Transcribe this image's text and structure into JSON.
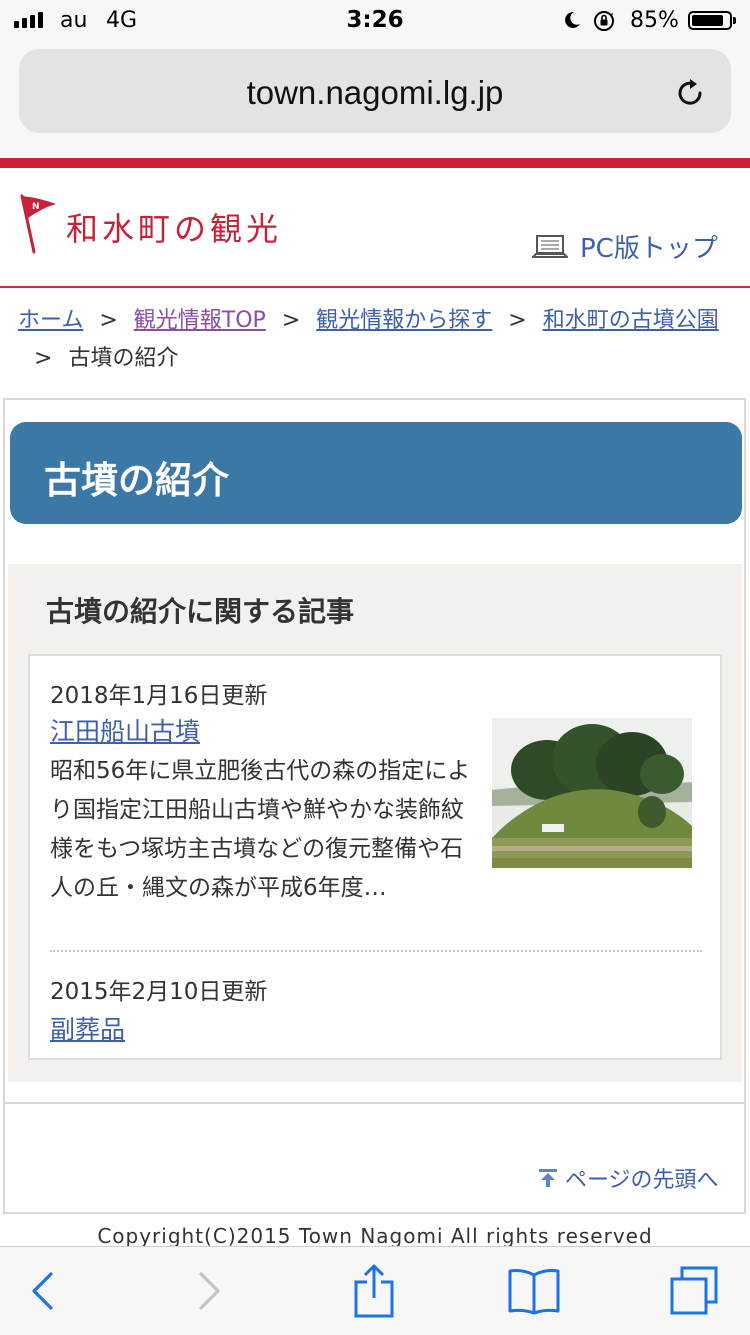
{
  "status_bar": {
    "carrier": "au",
    "network": "4G",
    "time": "3:26",
    "battery_percent": "85%",
    "battery_level": 0.85,
    "icons": [
      "signal-icon",
      "moon-icon",
      "rotation-lock-icon",
      "battery-icon"
    ]
  },
  "browser": {
    "url": "town.nagomi.lg.jp",
    "reload_icon": "reload-icon"
  },
  "header": {
    "logo_text": "和水町の観光",
    "logo_icon": "flag-icon",
    "pc_link_label": "PC版トップ",
    "pc_icon": "laptop-icon"
  },
  "breadcrumb": {
    "items": [
      "ホーム",
      "観光情報TOP",
      "観光情報から探す",
      "和水町の古墳公園"
    ],
    "current": "古墳の紹介",
    "separator": ">"
  },
  "main": {
    "page_title": "古墳の紹介",
    "articles_heading": "古墳の紹介に関する記事",
    "articles": [
      {
        "updated": "2018年1月16日更新",
        "title": "江田船山古墳",
        "description": "昭和56年に県立肥後古代の森の指定により国指定江田船山古墳や鮮やかな装飾紋様をもつ塚坊主古墳などの復元整備や石人の丘・縄文の森が平成6年度…",
        "thumbnail": "burial-mound-photo"
      },
      {
        "updated": "2015年2月10日更新",
        "title": "副葬品"
      }
    ],
    "to_top_label": "ページの先頭へ",
    "to_top_icon": "arrow-up-icon"
  },
  "footer": {
    "copyright": "Copyright(C)2015 Town Nagomi All rights reserved"
  },
  "toolbar": {
    "icons": [
      "back-icon",
      "forward-icon",
      "share-icon",
      "bookmarks-icon",
      "tabs-icon"
    ]
  },
  "colors": {
    "accent_red": "#cc2035",
    "heading_blue": "#3c78a6",
    "link_blue": "#3d5fae",
    "visited_purple": "#8b4ca8",
    "ios_blue": "#1a73e8"
  }
}
